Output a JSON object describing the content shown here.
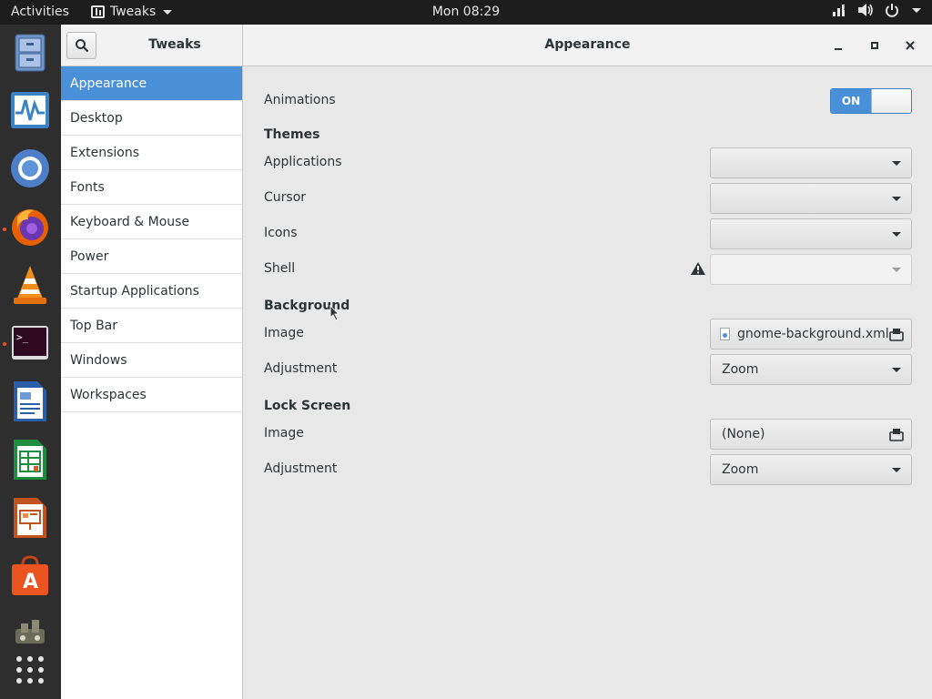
{
  "topbar": {
    "activities": "Activities",
    "app_menu": "Tweaks",
    "clock": "Mon 08:29"
  },
  "dock": {
    "items": [
      {
        "icon": "file-cabinet-icon"
      },
      {
        "icon": "system-monitor-icon"
      },
      {
        "icon": "chromium-icon"
      },
      {
        "icon": "firefox-icon",
        "running": true
      },
      {
        "icon": "vlc-icon"
      },
      {
        "icon": "terminal-icon",
        "running": true
      },
      {
        "icon": "libreoffice-writer-icon"
      },
      {
        "icon": "libreoffice-calc-icon"
      },
      {
        "icon": "libreoffice-impress-icon"
      },
      {
        "icon": "software-center-icon"
      },
      {
        "icon": "tweaks-app-icon"
      },
      {
        "icon": "show-applications-icon"
      }
    ]
  },
  "window": {
    "sidebar_title": "Tweaks",
    "page_title": "Appearance",
    "controls": {
      "minimize": "_",
      "maximize": "▫",
      "close": "×"
    }
  },
  "sidebar": {
    "items": [
      {
        "label": "Appearance",
        "selected": true
      },
      {
        "label": "Desktop"
      },
      {
        "label": "Extensions"
      },
      {
        "label": "Fonts"
      },
      {
        "label": "Keyboard & Mouse"
      },
      {
        "label": "Power"
      },
      {
        "label": "Startup Applications"
      },
      {
        "label": "Top Bar"
      },
      {
        "label": "Windows"
      },
      {
        "label": "Workspaces"
      }
    ]
  },
  "appearance": {
    "animations": {
      "label": "Animations",
      "state": "ON"
    },
    "themes": {
      "heading": "Themes",
      "applications": {
        "label": "Applications",
        "value": ""
      },
      "cursor": {
        "label": "Cursor",
        "value": ""
      },
      "icons": {
        "label": "Icons",
        "value": ""
      },
      "shell": {
        "label": "Shell",
        "value": "",
        "warning_icon": "warning-icon"
      }
    },
    "background": {
      "heading": "Background",
      "image": {
        "label": "Image",
        "value": "gnome-background.xml"
      },
      "adjustment": {
        "label": "Adjustment",
        "value": "Zoom"
      }
    },
    "lock_screen": {
      "heading": "Lock Screen",
      "image": {
        "label": "Image",
        "value": "(None)"
      },
      "adjustment": {
        "label": "Adjustment",
        "value": "Zoom"
      }
    }
  },
  "colors": {
    "accent": "#4a90d9",
    "ubuntu_orange": "#e95420"
  }
}
